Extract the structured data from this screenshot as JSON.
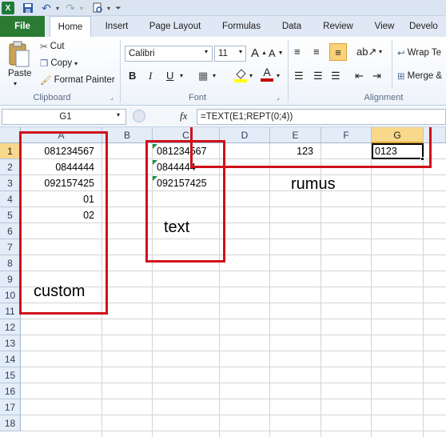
{
  "quick_access": {
    "icons": [
      "excel-icon",
      "save-icon",
      "undo-icon",
      "redo-icon",
      "print-preview-icon",
      "customize-icon"
    ]
  },
  "tabs": {
    "file": "File",
    "home": "Home",
    "insert": "Insert",
    "page_layout": "Page Layout",
    "formulas": "Formulas",
    "data": "Data",
    "review": "Review",
    "view": "View",
    "developer": "Develo"
  },
  "clipboard": {
    "paste": "Paste",
    "cut": "Cut",
    "copy": "Copy",
    "format_painter": "Format Painter",
    "label": "Clipboard"
  },
  "font": {
    "name": "Calibri",
    "size": "11",
    "bold": "B",
    "italic": "I",
    "underline": "U",
    "font_color_letter": "A",
    "fill_color": "#ffff00",
    "text_color": "#c00000",
    "label": "Font"
  },
  "alignment": {
    "wrap_text": "Wrap Te",
    "merge": "Merge &",
    "label": "Alignment"
  },
  "formula_bar": {
    "name_box": "G1",
    "fx": "fx",
    "formula": "=TEXT(E1;REPT(0;4))"
  },
  "columns": [
    "A",
    "B",
    "C",
    "D",
    "E",
    "F",
    "G"
  ],
  "rows": [
    "1",
    "2",
    "3",
    "4",
    "5",
    "6",
    "7",
    "8",
    "9",
    "10",
    "11",
    "12",
    "13",
    "14",
    "15",
    "16",
    "17",
    "18"
  ],
  "cells": {
    "A1": "081234567",
    "A2": "0844444",
    "A3": "092157425",
    "A4": "01",
    "A5": "02",
    "C1": "081234567",
    "C2": "0844444",
    "C3": "092157425",
    "E1": "123",
    "G1": "0123"
  },
  "annotations": {
    "custom": "custom",
    "text": "text",
    "rumus": "rumus",
    "color": "#d0101a"
  }
}
